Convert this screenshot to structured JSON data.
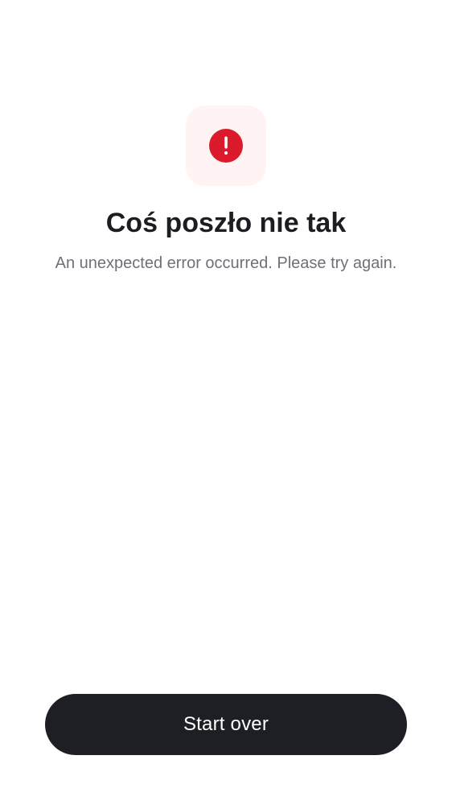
{
  "error": {
    "icon": "exclamation-circle-icon",
    "accent_color": "#db1b2c",
    "tile_color": "#fff4f3",
    "title": "Coś poszło nie tak",
    "message": "An unexpected error occurred. Please try again."
  },
  "actions": {
    "start_over_label": "Start over"
  }
}
